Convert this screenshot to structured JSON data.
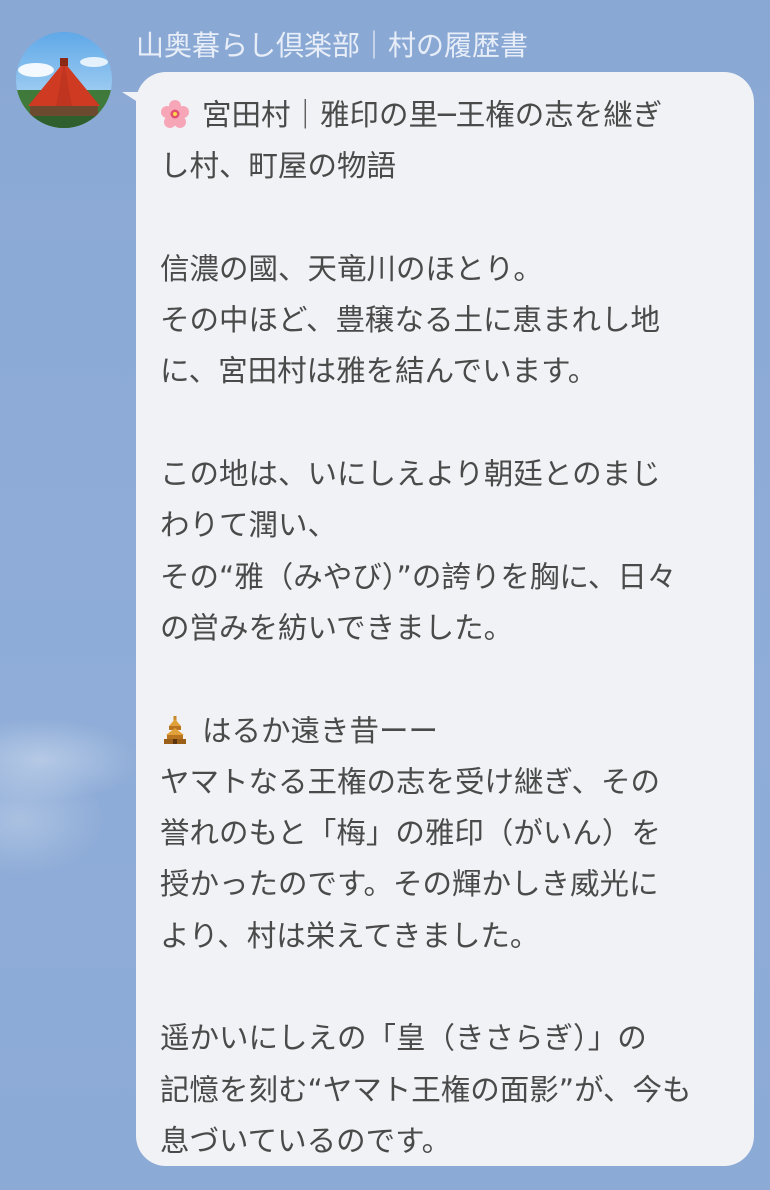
{
  "chat": {
    "sender_name": "山奥暮らし倶楽部｜村の履歴書",
    "avatar_icon": "red-roof-farmhouse-avatar",
    "message": {
      "title_icon": "cherry-blossom-icon",
      "title_lines": [
        "宮田村｜雅印の里─王権の志を継ぎ",
        "し村、町屋の物語"
      ],
      "paragraph1": [
        "信濃の國、天竜川のほとり。",
        "その中ほど、豊穣なる土に恵まれし地",
        "に、宮田村は雅を結んでいます。"
      ],
      "paragraph2": [
        "この地は、いにしえより朝廷とのまじ",
        "わりて潤い、",
        "その“雅（みやび）”の誇りを胸に、日々",
        "の営みを紡いできました。"
      ],
      "section_icon": "temple-pagoda-icon",
      "paragraph3": [
        "はるか遠き昔ーー",
        "ヤマトなる王権の志を受け継ぎ、その",
        "誉れのもと「梅」の雅印（がいん）を",
        "授かったのです。その輝かしき威光に",
        "より、村は栄えてきました。"
      ],
      "paragraph4": [
        "遥かいにしえの「皇（きさらぎ）」の",
        "記憶を刻む“ヤマト王権の面影”が、今も",
        "息づいているのです。"
      ]
    }
  },
  "colors": {
    "background": "#8eabd6",
    "bubble": "#f1f2f5",
    "text": "#4a4a4a",
    "sender_name": "#e8eef8"
  }
}
